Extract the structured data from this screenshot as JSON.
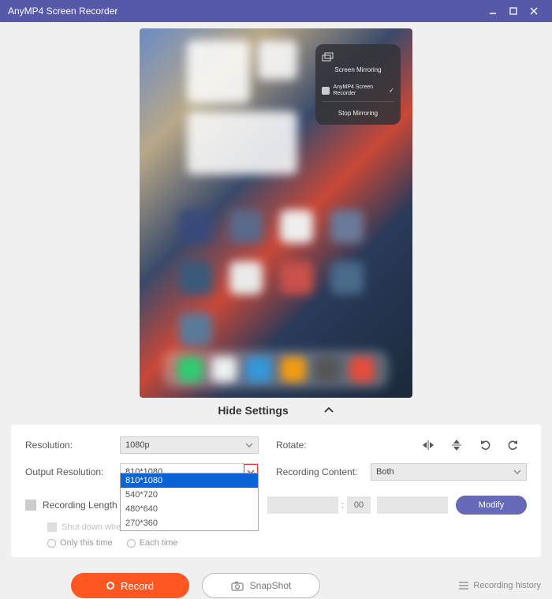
{
  "titlebar": {
    "title": "AnyMP4 Screen Recorder"
  },
  "mirror": {
    "title": "Screen Mirroring",
    "item": "AnyMP4 Screen Recorder",
    "stop": "Stop Mirroring"
  },
  "hide_settings": "Hide Settings",
  "settings": {
    "resolution_label": "Resolution:",
    "resolution_value": "1080p",
    "output_res_label": "Output Resolution:",
    "output_res_value": "810*1080",
    "output_res_options": [
      "810*1080",
      "540*720",
      "480*640",
      "270*360"
    ],
    "rotate_label": "Rotate:",
    "recording_content_label": "Recording Content:",
    "recording_content_value": "Both",
    "recording_length_label": "Recording Length",
    "time_hh": "",
    "time_mm": "",
    "time_ss": "00",
    "modify": "Modify",
    "shutdown": "Shut down when recording ends",
    "only_this": "Only this time",
    "each_time": "Each time"
  },
  "bottom": {
    "record": "Record",
    "snapshot": "SnapShot",
    "history": "Recording history"
  }
}
